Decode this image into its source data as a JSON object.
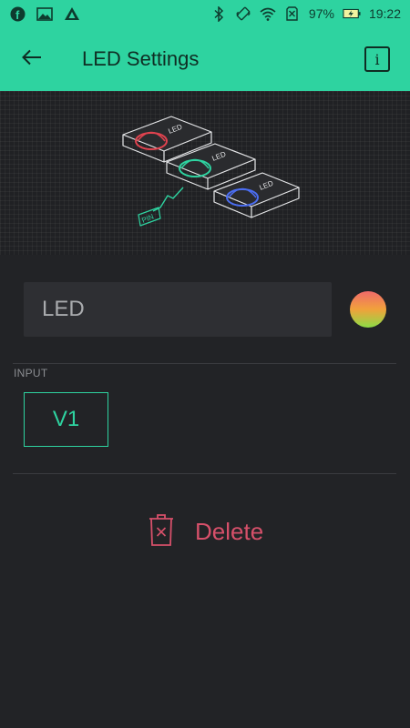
{
  "status_bar": {
    "battery_percent": "97%",
    "time": "19:22",
    "left_icons": [
      "facebook-icon",
      "image-icon",
      "triangle-app-icon"
    ],
    "right_icons": [
      "bluetooth-icon",
      "vibrate-icon",
      "wifi-icon",
      "no-sim-icon",
      "battery-charging-icon"
    ]
  },
  "toolbar": {
    "title": "LED Settings",
    "back_icon": "arrow-left-icon",
    "info_label": "i"
  },
  "illustration": {
    "led_labels": [
      "LED",
      "LED",
      "LED"
    ],
    "pin_label": "PIN",
    "led_colors": [
      "#e0434f",
      "#2ed3a0",
      "#4b6df0"
    ]
  },
  "form": {
    "name_value": "LED",
    "color_swatch": "#f1a23b"
  },
  "input": {
    "section_label": "INPUT",
    "pin_value": "V1"
  },
  "actions": {
    "delete_label": "Delete",
    "delete_icon": "trash-icon"
  },
  "colors": {
    "accent": "#2ed3a0",
    "background": "#222326",
    "danger": "#d6506a"
  }
}
